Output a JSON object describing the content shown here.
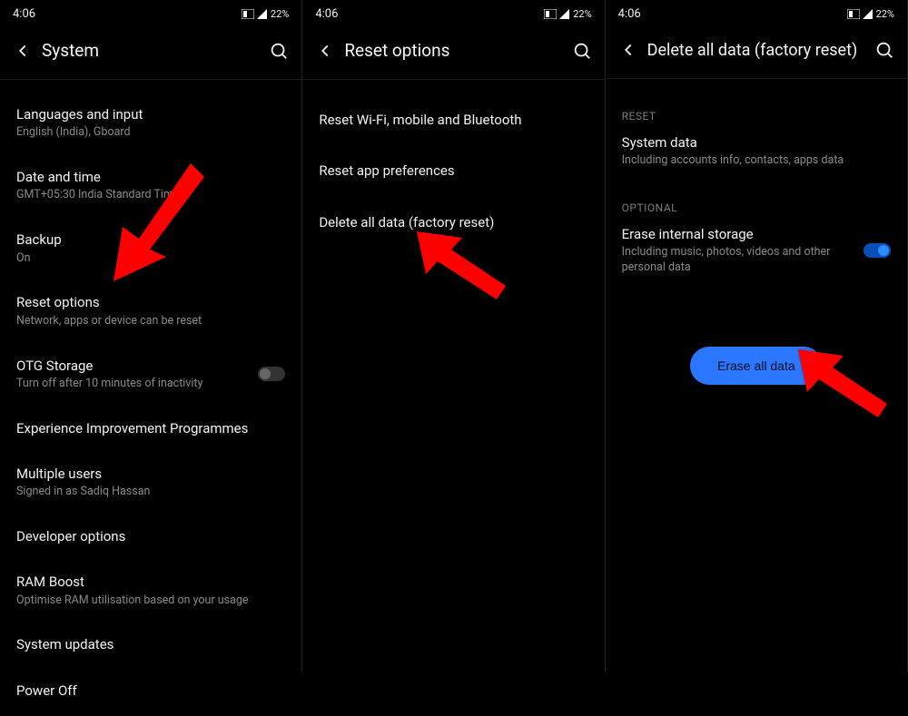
{
  "status": {
    "time": "4:06",
    "battery": "22%"
  },
  "screen1": {
    "title": "System",
    "items": [
      {
        "title": "Languages and input",
        "sub": "English (India), Gboard"
      },
      {
        "title": "Date and time",
        "sub": "GMT+05:30 India Standard Time"
      },
      {
        "title": "Backup",
        "sub": "On"
      },
      {
        "title": "Reset options",
        "sub": "Network, apps or device can be reset"
      },
      {
        "title": "OTG Storage",
        "sub": "Turn off after 10 minutes of inactivity"
      },
      {
        "title": "Experience Improvement Programmes"
      },
      {
        "title": "Multiple users",
        "sub": "Signed in as Sadiq Hassan"
      },
      {
        "title": "Developer options"
      },
      {
        "title": "RAM Boost",
        "sub": "Optimise RAM utilisation based on your usage"
      },
      {
        "title": "System updates"
      },
      {
        "title": "Power Off"
      }
    ]
  },
  "screen2": {
    "title": "Reset options",
    "items": [
      {
        "title": "Reset Wi-Fi, mobile and Bluetooth"
      },
      {
        "title": "Reset app preferences"
      },
      {
        "title": "Delete all data (factory reset)"
      }
    ]
  },
  "screen3": {
    "title": "Delete all data (factory reset)",
    "section_reset": "RESET",
    "system_data": {
      "title": "System data",
      "sub": "Including accounts info, contacts, apps data"
    },
    "section_optional": "OPTIONAL",
    "erase_storage": {
      "title": "Erase internal storage",
      "sub": "Including music, photos, videos and other personal data"
    },
    "button": "Erase all data"
  }
}
